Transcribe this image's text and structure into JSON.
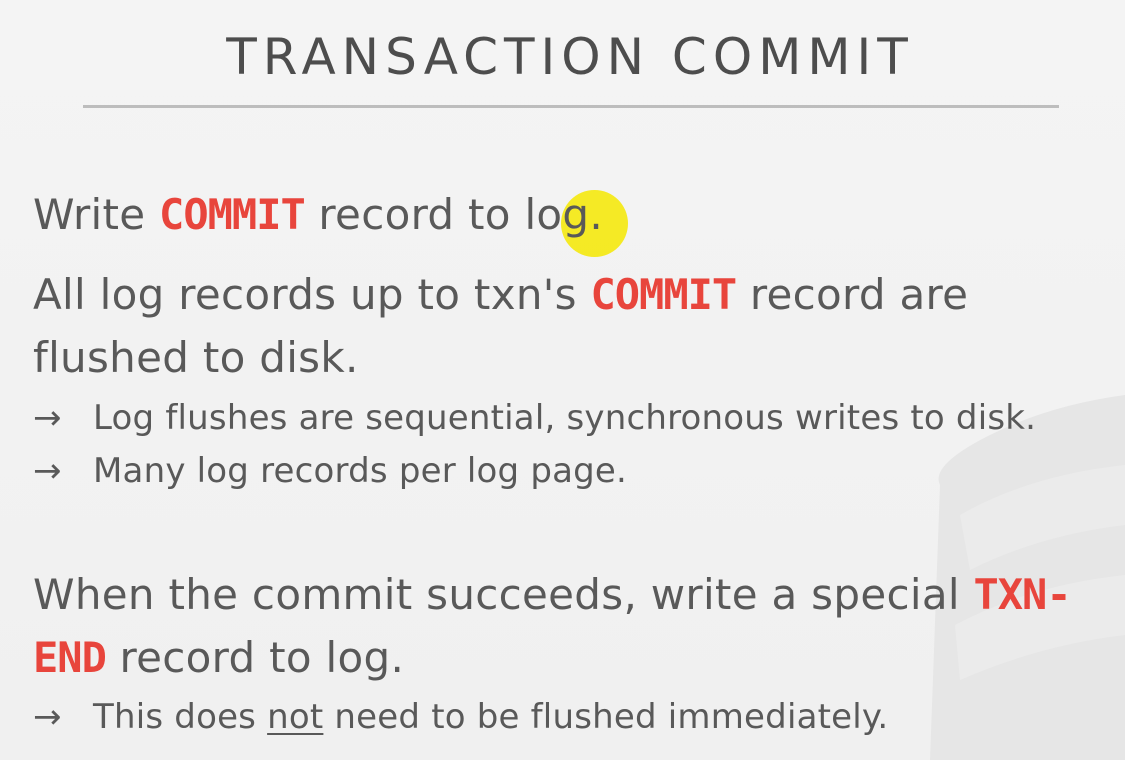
{
  "slide": {
    "title": "TRANSACTION COMMIT",
    "line1": {
      "pre": "Write ",
      "keyword": "COMMIT",
      "post": " record to log."
    },
    "line2": {
      "pre": "All log records up to txn's ",
      "keyword": "COMMIT",
      "post": " record are"
    },
    "line3": "flushed to disk.",
    "bullet1": "Log flushes are sequential, synchronous writes to disk.",
    "bullet2": "Many log records per log page.",
    "line4": {
      "pre": "When the commit succeeds, write a special ",
      "keyword": "TXN-"
    },
    "line5": {
      "keyword": "END",
      "post": " record to log."
    },
    "bullet3": {
      "pre": "This does ",
      "emph": "not",
      "post": " need to be flushed immediately."
    },
    "arrow_glyph": "→"
  },
  "colors": {
    "keyword": "#e8453c",
    "text": "#595959",
    "background": "#f2f2f2",
    "cursor_highlight": "#f5e800"
  },
  "icons": {
    "pointer": "mouse-pointer-highlight",
    "watermark": "database-cylinder-watermark"
  }
}
